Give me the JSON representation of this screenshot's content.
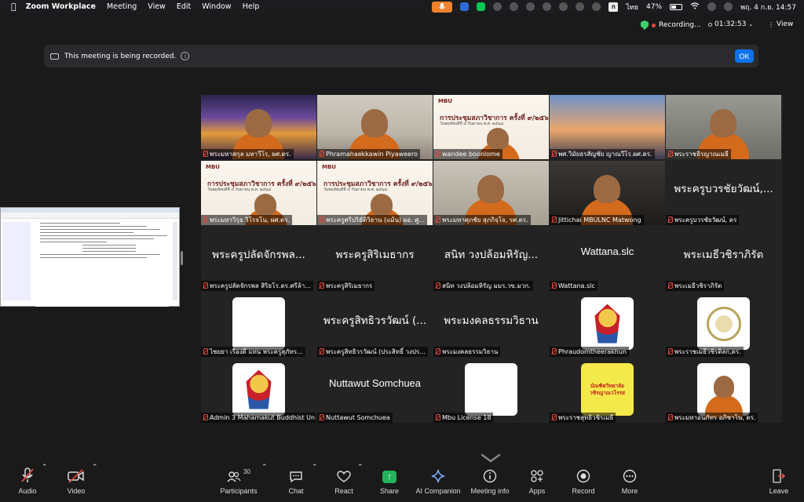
{
  "menubar": {
    "app": "Zoom Workplace",
    "items": [
      "Meeting",
      "View",
      "Edit",
      "Window",
      "Help"
    ],
    "input_source": "ไทย",
    "battery": "47%",
    "clock": "พฤ. 4 ก.ย.  14:57"
  },
  "status": {
    "recording": "Recording...",
    "timer": "01:32:53",
    "view": "View"
  },
  "banner": {
    "text": "This meeting is being recorded.",
    "ok": "OK"
  },
  "tiles": [
    {
      "name": "พระมหาสกุล มหาวีโร, ผศ.ดร.",
      "kind": "video",
      "bg": "wat"
    },
    {
      "name": "Phramahaekkawin Piyaweero",
      "kind": "video",
      "bg": "room"
    },
    {
      "name": "wandee boonlome",
      "kind": "slide",
      "slide_hdr": "MBU",
      "slide_title": "การประชุมสภาวิชาการ ครั้งที่ ๙/๒๕๖๘",
      "slide_sub": "วันพฤหัสบดีที่ ๔ กันยายน พ.ศ. ๒๕๖๘"
    },
    {
      "name": "พศ.วิมัยธรสัญชัย ญาณวีโร.ผศ.ดร.",
      "kind": "video",
      "bg": "bridge"
    },
    {
      "name": "พระราชธิรญาณเมธี",
      "kind": "video",
      "bg": "mono"
    },
    {
      "name": "พระมหาวิรุธ วิโรจโน, ผศ.ดร.",
      "kind": "slide",
      "slide_hdr": "MBU",
      "slide_title": "การประชุมสภาวิชาการ ครั้งที่ ๙/๒๕๖๘",
      "slide_sub": "วันพฤหัสบดีที่ ๔ กันยายน พ.ศ. ๒๕๖๘"
    },
    {
      "name": "พระครูศรีปริยัติวิธาน (แม้น) ผอ. ศู...",
      "kind": "slide",
      "slide_hdr": "MBU",
      "slide_title": "การประชุมสภาวิชาการ ครั้งที่ ๙/๒๕๖๘",
      "slide_sub": "วันพฤหัสบดีที่ ๔ กันยายน พ.ศ. ๒๕๖๘"
    },
    {
      "name": "พระมหาศุภชัย สุภกิจฺโจ, รศ.ดร.",
      "kind": "video",
      "bg": "office"
    },
    {
      "name": "Jittichai MBULNC Matwong",
      "kind": "video",
      "bg": "dark"
    },
    {
      "name": "พระครูบวรชัยวัฒน์, ดร",
      "kind": "text",
      "big": "พระครูบวรชัยวัฒน์,..."
    },
    {
      "name": "พระครูปลัดจักรพล สิริธโร.ดร.ศรีล้า...",
      "kind": "text",
      "big": "พระครูปลัดจักรพล..."
    },
    {
      "name": "พระครูสิริเมธากร",
      "kind": "text",
      "big": "พระครูสิริเมธากร"
    },
    {
      "name": "สนิท  วงปล้อมหิรัญ มมร.วข.มวก.",
      "kind": "text",
      "big": "สนิท  วงปล้อมหิรัญ..."
    },
    {
      "name": "Wattana.slc",
      "kind": "text",
      "big": "Wattana.slc",
      "en": true
    },
    {
      "name": "พระเมธีวชิราภิรัต",
      "kind": "text",
      "big": "พระเมธีวชิราภิรัต"
    },
    {
      "name": "ไชยยา  เรืองดี  แทน  พระครูสุภัทร...",
      "kind": "pic",
      "pic": "building"
    },
    {
      "name": "พระครูสิทธิวรวัฒน์ (ประสิทธิ์ วงปร...",
      "kind": "text",
      "big": "พระครูสิทธิวรวัฒน์ (..."
    },
    {
      "name": "พระมงคลธรรมวิธาน",
      "kind": "text",
      "big": "พระมงคลธรรมวิธาน"
    },
    {
      "name": "Phraudomtheerakhun",
      "kind": "pic",
      "pic": "emblem"
    },
    {
      "name": "พระราชเมธีวชิรดิลก,ดร.",
      "kind": "pic",
      "pic": "seal"
    },
    {
      "name": "Admin 3 Mahamakut Buddhist Un...",
      "kind": "pic",
      "pic": "emblem"
    },
    {
      "name": "Nuttawut Somchuea",
      "kind": "text",
      "big": "Nuttawut Somchuea",
      "en": true
    },
    {
      "name": "Mbu License 18",
      "kind": "pic",
      "pic": "trees"
    },
    {
      "name": "พระราชสุทธิวชิรเมธี",
      "kind": "pic",
      "pic": "yellow",
      "card_lines": [
        "บัณฑิตวิทยาลัย",
        "วชิรญาณวโรรส"
      ]
    },
    {
      "name": "พระมหาอนภัทร อภิชาโน, ดร.",
      "kind": "pic",
      "pic": "monk"
    }
  ],
  "toolbar": {
    "audio": "Audio",
    "video": "Video",
    "participants": "Participants",
    "participants_count": "30",
    "chat": "Chat",
    "react": "React",
    "share": "Share",
    "ai": "AI Companion",
    "info": "Meeting info",
    "apps": "Apps",
    "record": "Record",
    "more": "More",
    "leave": "Leave"
  },
  "colors": {
    "accent_blue": "#0e72ed",
    "share_green": "#23b35c",
    "mute_red": "#e3493d",
    "tray_orange": "#f0822e"
  }
}
